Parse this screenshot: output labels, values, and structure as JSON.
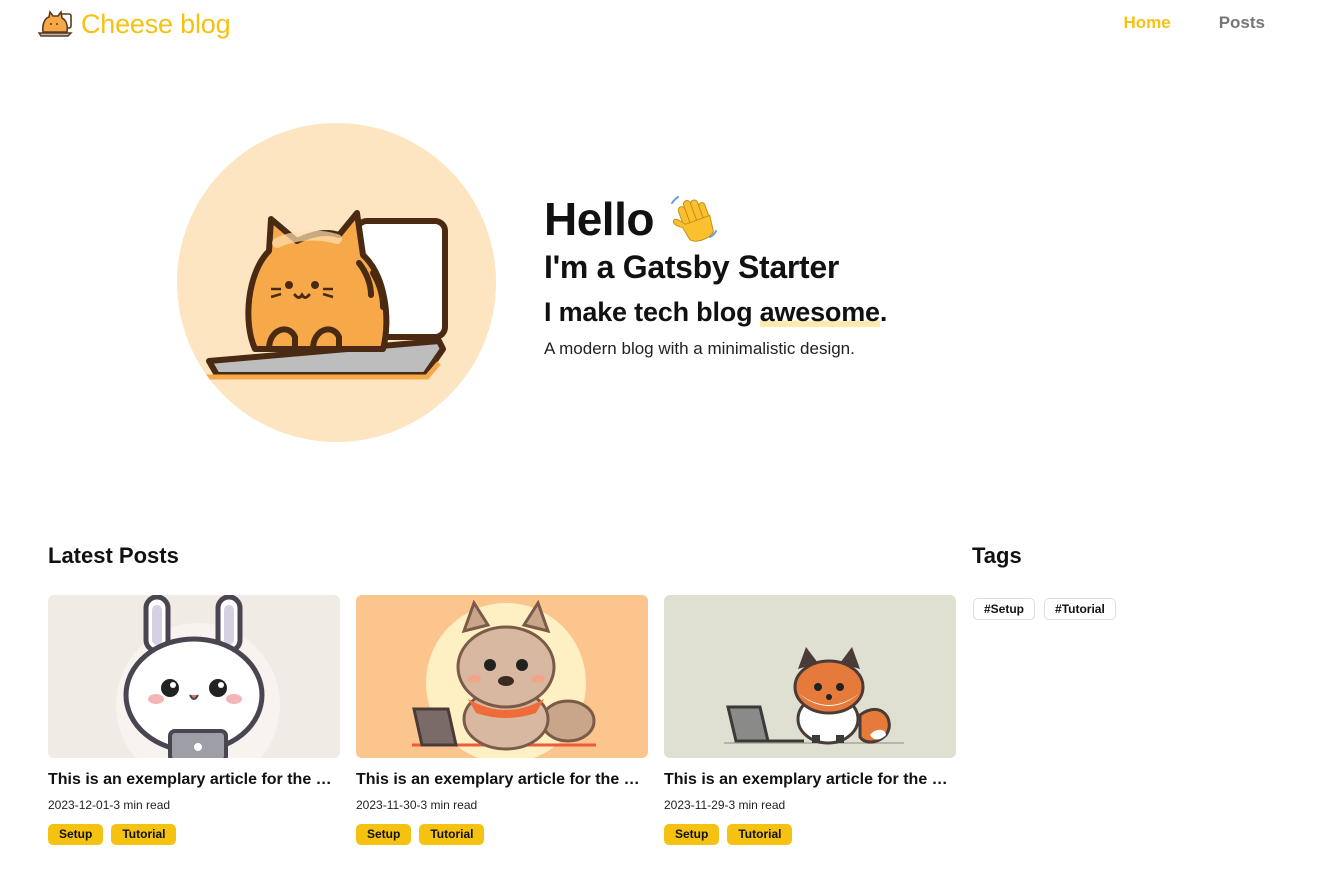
{
  "header": {
    "logo_icon": "cat-on-laptop-icon",
    "logo_text": "Cheese blog",
    "nav": [
      {
        "label": "Home",
        "active": true
      },
      {
        "label": "Posts",
        "active": false
      }
    ]
  },
  "hero": {
    "avatar_icon": "cat-on-laptop-illustration",
    "hello": "Hello",
    "wave_icon": "waving-hand-icon",
    "subtitle": "I'm a Gatsby Starter",
    "tagline_prefix": "I make tech blog ",
    "tagline_highlight": "awesome",
    "tagline_suffix": ".",
    "description": "A modern blog with a minimalistic design."
  },
  "latest": {
    "title": "Latest Posts",
    "posts": [
      {
        "image": "bunny-with-laptop-illustration",
        "title": "This is an exemplary article for the blog template",
        "meta": "2023-12-01-3 min read",
        "tags": [
          "Setup",
          "Tutorial"
        ]
      },
      {
        "image": "dog-with-laptop-illustration",
        "title": "This is an exemplary article for the blog template",
        "meta": "2023-11-30-3 min read",
        "tags": [
          "Setup",
          "Tutorial"
        ]
      },
      {
        "image": "fox-with-laptop-illustration",
        "title": "This is an exemplary article for the blog template",
        "meta": "2023-11-29-3 min read",
        "tags": [
          "Setup",
          "Tutorial"
        ]
      }
    ]
  },
  "tags": {
    "title": "Tags",
    "items": [
      "#Setup",
      "#Tutorial"
    ]
  },
  "colors": {
    "accent": "#f5c211",
    "nav_inactive": "#777777",
    "avatar_bg": "#fde5c2",
    "highlight": "#fdeab0"
  }
}
